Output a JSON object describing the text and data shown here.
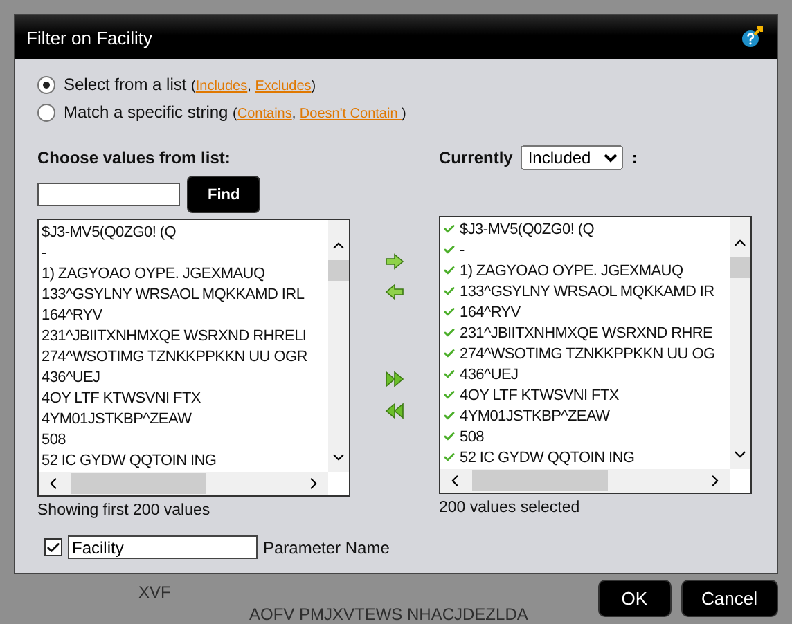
{
  "window": {
    "title": "Filter on Facility"
  },
  "modes": [
    {
      "parts": [
        {
          "kind": "text",
          "text": "Select from a list "
        },
        {
          "kind": "small",
          "text": "("
        },
        {
          "kind": "link",
          "text": "Includes"
        },
        {
          "kind": "small",
          "text": ", "
        },
        {
          "kind": "link",
          "text": "Excludes"
        },
        {
          "kind": "small",
          "text": ")"
        }
      ],
      "selected": true
    },
    {
      "parts": [
        {
          "kind": "text",
          "text": "Match a specific string "
        },
        {
          "kind": "small",
          "text": "("
        },
        {
          "kind": "link",
          "text": "Contains"
        },
        {
          "kind": "small",
          "text": ", "
        },
        {
          "kind": "link",
          "text": "Doesn't Contain "
        },
        {
          "kind": "small",
          "text": ")"
        }
      ],
      "selected": false
    }
  ],
  "source": {
    "heading": "Choose values from list:",
    "find_button": "Find",
    "items": [
      "$J3-MV5(Q0ZG0! (Q",
      "-",
      "1) ZAGYOAO OYPE. JGEXMAUQ",
      "133^GSYLNY WRSAOL MQKKAMD IRL",
      "164^RYV",
      "231^JBIITXNHMXQE WSRXND RHRELI",
      "274^WSOTIMG TZNKKPPKKN UU OGR",
      "436^UEJ",
      "4OY LTF KTWSVNI FTX",
      "4YM01JSTKBP^ZEAW",
      "508",
      "52 IC GYDW QQTOIN ING"
    ],
    "status": "Showing first 200 values"
  },
  "target": {
    "heading": "Currently",
    "mode": "Included",
    "colon": ":",
    "items": [
      {
        "text": "$J3-MV5(Q0ZG0! (Q",
        "checked": true
      },
      {
        "text": "-",
        "checked": true
      },
      {
        "text": "1) ZAGYOAO OYPE. JGEXMAUQ",
        "checked": true
      },
      {
        "text": "133^GSYLNY WRSAOL MQKKAMD IR",
        "checked": true
      },
      {
        "text": "164^RYV",
        "checked": true
      },
      {
        "text": "231^JBIITXNHMXQE WSRXND RHRE",
        "checked": true
      },
      {
        "text": "274^WSOTIMG TZNKKPPKKN UU OG",
        "checked": true
      },
      {
        "text": "436^UEJ",
        "checked": true
      },
      {
        "text": "4OY LTF KTWSVNI FTX",
        "checked": true
      },
      {
        "text": "4YM01JSTKBP^ZEAW",
        "checked": true
      },
      {
        "text": "508",
        "checked": true
      },
      {
        "text": "52 IC GYDW QQTOIN ING",
        "checked": true
      }
    ],
    "status": "200 values selected"
  },
  "parameter": {
    "checked": true,
    "value": "Facility",
    "label": "Parameter Name"
  },
  "backdrop": [
    "XVF",
    "AOFV PMJXVTEWS NHACJDEZLDA"
  ],
  "buttons": [
    "OK",
    "Cancel"
  ]
}
